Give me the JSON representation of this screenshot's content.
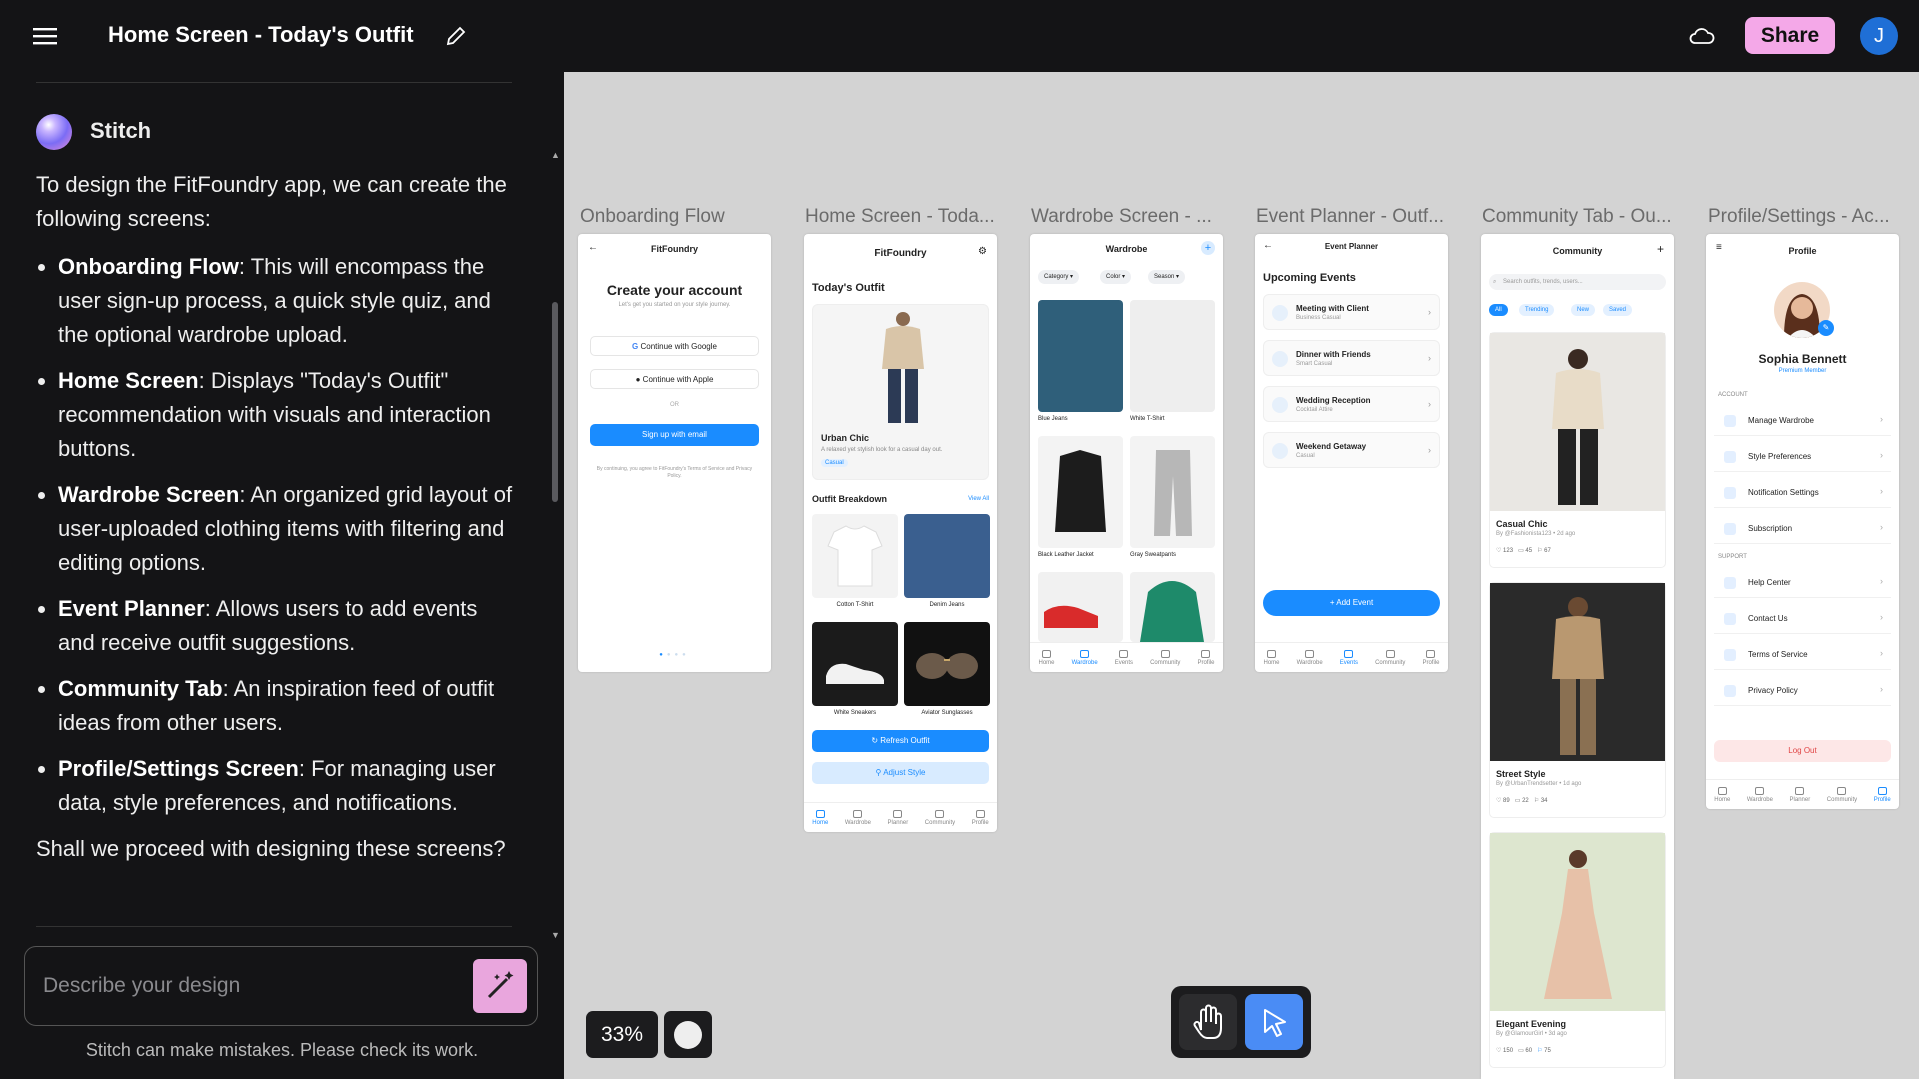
{
  "topbar": {
    "title": "Home Screen - Today's Outfit",
    "share_label": "Share",
    "avatar_initial": "J",
    "icons": [
      "menu-icon",
      "pencil-icon",
      "cloud-icon"
    ]
  },
  "chat": {
    "sender": "Stitch",
    "intro": "To design the FitFoundry app, we can create the following screens:",
    "items": [
      {
        "name": "Onboarding Flow",
        "desc": ": This will encompass the user sign-up process, a quick style quiz, and the optional wardrobe upload."
      },
      {
        "name": "Home Screen",
        "desc": ": Displays \"Today's Outfit\" recommendation with visuals and interaction buttons."
      },
      {
        "name": "Wardrobe Screen",
        "desc": ": An organized grid layout of user-uploaded clothing items with filtering and editing options."
      },
      {
        "name": "Event Planner",
        "desc": ": Allows users to add events and receive outfit suggestions."
      },
      {
        "name": "Community Tab",
        "desc": ": An inspiration feed of outfit ideas from other users."
      },
      {
        "name": "Profile/Settings Screen",
        "desc": ": For managing user data, style preferences, and notifications."
      }
    ],
    "closing": "Shall we proceed with designing these screens?",
    "input_placeholder": "Describe your design",
    "disclaimer": "Stitch can make mistakes. Please check its work."
  },
  "canvas": {
    "zoom": "33%",
    "frame_labels": [
      "Onboarding Flow",
      "Home Screen - Toda...",
      "Wardrobe Screen - ...",
      "Event Planner - Outf...",
      "Community Tab - Ou...",
      "Profile/Settings - Ac..."
    ],
    "onboarding": {
      "app": "FitFoundry",
      "heading": "Create your account",
      "sub": "Let's get you started on your style journey.",
      "google": "Continue with Google",
      "apple": "Continue with Apple",
      "or": "OR",
      "email": "Sign up with email",
      "terms": "By continuing, you agree to FitFoundry's Terms of Service and Privacy Policy."
    },
    "home": {
      "app": "FitFoundry",
      "section": "Today's Outfit",
      "outfit_name": "Urban Chic",
      "outfit_desc": "A relaxed yet stylish look for a casual day out.",
      "tag": "Casual",
      "breakdown": "Outfit Breakdown",
      "view_all": "View All",
      "items": [
        "Cotton T-Shirt",
        "Denim Jeans",
        "White Sneakers",
        "Aviator Sunglasses"
      ],
      "refresh": "Refresh Outfit",
      "adjust": "Adjust Style",
      "nav": [
        "Home",
        "Wardrobe",
        "Planner",
        "Community",
        "Profile"
      ]
    },
    "wardrobe": {
      "title": "Wardrobe",
      "filters": [
        "Category",
        "Color",
        "Season"
      ],
      "items": [
        "Blue Jeans",
        "White T-Shirt",
        "Black Leather Jacket",
        "Gray Sweatpants"
      ],
      "nav": [
        "Home",
        "Wardrobe",
        "Events",
        "Community",
        "Profile"
      ]
    },
    "events": {
      "title": "Event Planner",
      "section": "Upcoming Events",
      "list": [
        {
          "name": "Meeting with Client",
          "type": "Business Casual"
        },
        {
          "name": "Dinner with Friends",
          "type": "Smart Casual"
        },
        {
          "name": "Wedding Reception",
          "type": "Cocktail Attire"
        },
        {
          "name": "Weekend Getaway",
          "type": "Casual"
        }
      ],
      "add": "Add Event",
      "nav": [
        "Home",
        "Wardrobe",
        "Events",
        "Community",
        "Profile"
      ]
    },
    "community": {
      "title": "Community",
      "search": "Search outfits, trends, users...",
      "chips": [
        "All",
        "Trending",
        "New",
        "Saved"
      ],
      "posts": [
        {
          "title": "Casual Chic",
          "by": "By @Fashionista123 • 2d ago",
          "likes": "123",
          "comments": "45",
          "saves": "67"
        },
        {
          "title": "Street Style",
          "by": "By @UrbanTrendsetter • 1d ago",
          "likes": "89",
          "comments": "22",
          "saves": "34"
        },
        {
          "title": "Elegant Evening",
          "by": "By @GlamourGirl • 3d ago",
          "likes": "150",
          "comments": "60",
          "saves": "75"
        }
      ]
    },
    "profile": {
      "title": "Profile",
      "name": "Sophia Bennett",
      "member": "Premium Member",
      "account_label": "ACCOUNT",
      "account": [
        "Manage Wardrobe",
        "Style Preferences",
        "Notification Settings",
        "Subscription"
      ],
      "support_label": "SUPPORT",
      "support": [
        "Help Center",
        "Contact Us",
        "Terms of Service",
        "Privacy Policy"
      ],
      "logout": "Log Out",
      "nav": [
        "Home",
        "Wardrobe",
        "Planner",
        "Community",
        "Profile"
      ]
    }
  }
}
